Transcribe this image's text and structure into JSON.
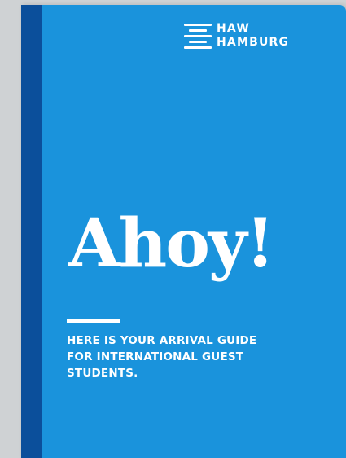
{
  "brand": {
    "line1": "HAW",
    "line2": "HAMBURG",
    "mark_icon": "haw-logo-lines-icon"
  },
  "cover": {
    "headline": "Ahoy!",
    "subtitle_lines": [
      "HERE IS YOUR ARRIVAL GUIDE",
      "FOR INTERNATIONAL GUEST",
      "STUDENTS."
    ]
  },
  "colors": {
    "cover_blue": "#1a93dc",
    "spine_blue": "#0b4f9b",
    "background": "#cfd2d4",
    "text": "#ffffff"
  }
}
